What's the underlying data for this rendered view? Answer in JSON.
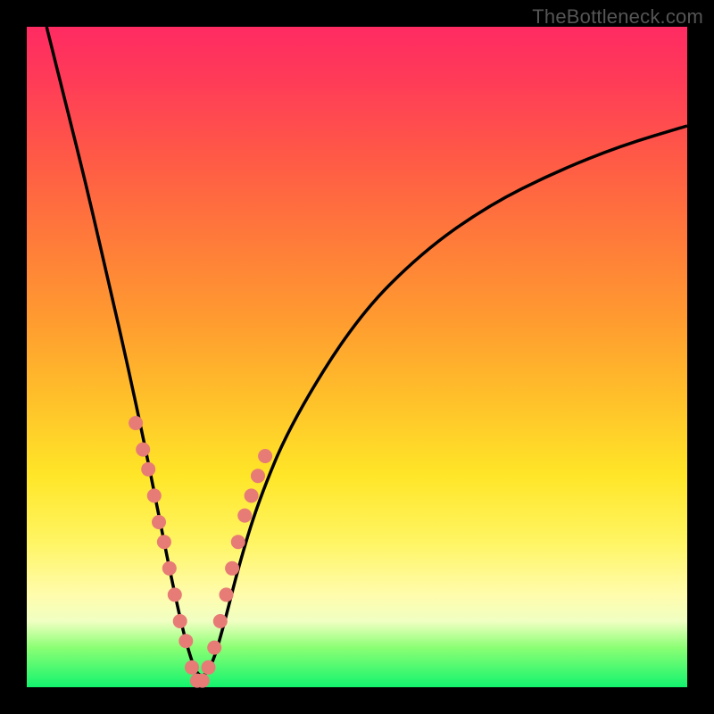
{
  "watermark": {
    "text": "TheBottleneck.com"
  },
  "colors": {
    "frame": "#000000",
    "curve": "#000000",
    "dot": "#e77b76",
    "gradient_stops": [
      "#ff2b62",
      "#ff3b58",
      "#ff5a46",
      "#ff7a3a",
      "#ff9a30",
      "#ffbf2a",
      "#ffe628",
      "#fff563",
      "#fffcac",
      "#f0ffc2",
      "#8bff74",
      "#13f36e"
    ]
  },
  "chart_data": {
    "type": "line",
    "title": "",
    "xlabel": "",
    "ylabel": "",
    "xlim": [
      0,
      100
    ],
    "ylim": [
      0,
      100
    ],
    "comment": "Single V-shaped curve. x in arbitrary 0–100 units across plot width; y = bottleneck % (0 at bottom/green, 100 at top/red). Minimum near x≈26. Dots highlight sampled points near the trough.",
    "series": [
      {
        "name": "bottleneck-curve",
        "x": [
          3,
          6,
          9,
          12,
          15,
          18,
          20,
          22,
          24,
          26,
          28,
          30,
          32,
          35,
          40,
          50,
          60,
          70,
          80,
          90,
          100
        ],
        "y": [
          100,
          88,
          76,
          63,
          50,
          36,
          26,
          16,
          7,
          1,
          3,
          10,
          18,
          28,
          40,
          56,
          66,
          73,
          78,
          82,
          85
        ]
      }
    ],
    "dots": {
      "comment": "Highlighted sample points clustered on both arms near the minimum.",
      "x": [
        16.5,
        17.6,
        18.4,
        19.3,
        20.0,
        20.8,
        21.6,
        22.4,
        23.2,
        24.1,
        25.0,
        25.8,
        26.6,
        27.5,
        28.4,
        29.3,
        30.2,
        31.1,
        32.0,
        33.0,
        34.0,
        35.0,
        36.1
      ],
      "y": [
        40,
        36,
        33,
        29,
        25,
        22,
        18,
        14,
        10,
        7,
        3,
        1,
        1,
        3,
        6,
        10,
        14,
        18,
        22,
        26,
        29,
        32,
        35
      ]
    }
  }
}
